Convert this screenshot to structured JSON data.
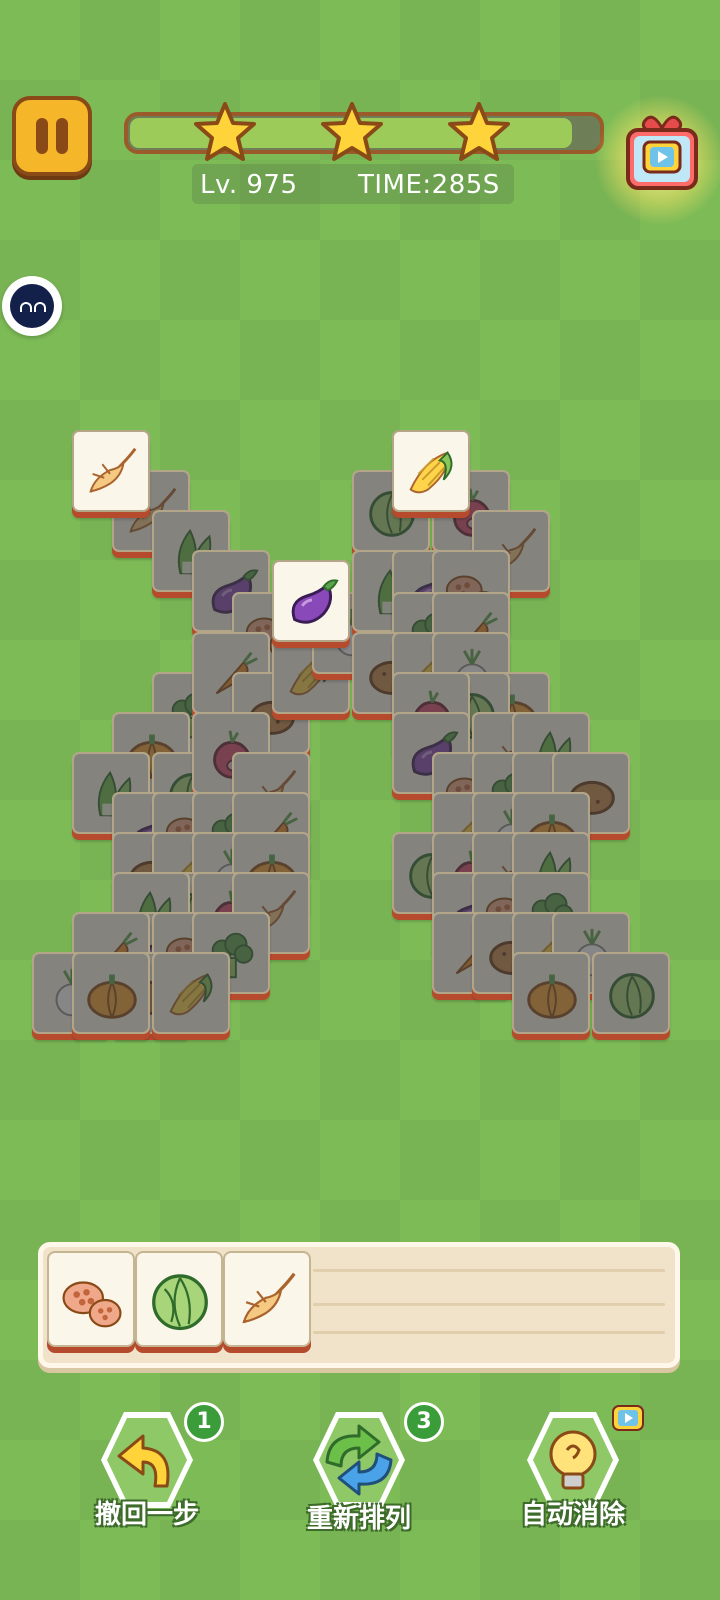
{
  "hud": {
    "level_label": "Lv. 975",
    "time_label": "TIME:285S",
    "progress": 0.94,
    "stars_count": 3
  },
  "icons": {
    "pause": "pause-icon",
    "gift": "gift-video-icon",
    "side_bubble": "mascot-face-icon",
    "undo": "undo-arrow-icon",
    "shuffle": "shuffle-arrows-icon",
    "hint": "lightbulb-icon"
  },
  "board": {
    "active_tiles": [
      "ginseng",
      "corn",
      "eggplant"
    ],
    "covered_tile_count": 71
  },
  "tray": {
    "slots": [
      "lotus-root",
      "cabbage",
      "ginseng"
    ],
    "capacity": 7
  },
  "tools": {
    "undo": {
      "label": "撤回一步",
      "count": "1"
    },
    "shuffle": {
      "label": "重新排列",
      "count": "3"
    },
    "auto": {
      "label": "自动消除"
    }
  },
  "colors": {
    "grass": "#7dbb57",
    "accent_orange": "#f5b62a",
    "tile_face": "#fbf6ea",
    "tile_edge": "#b54a2c"
  }
}
